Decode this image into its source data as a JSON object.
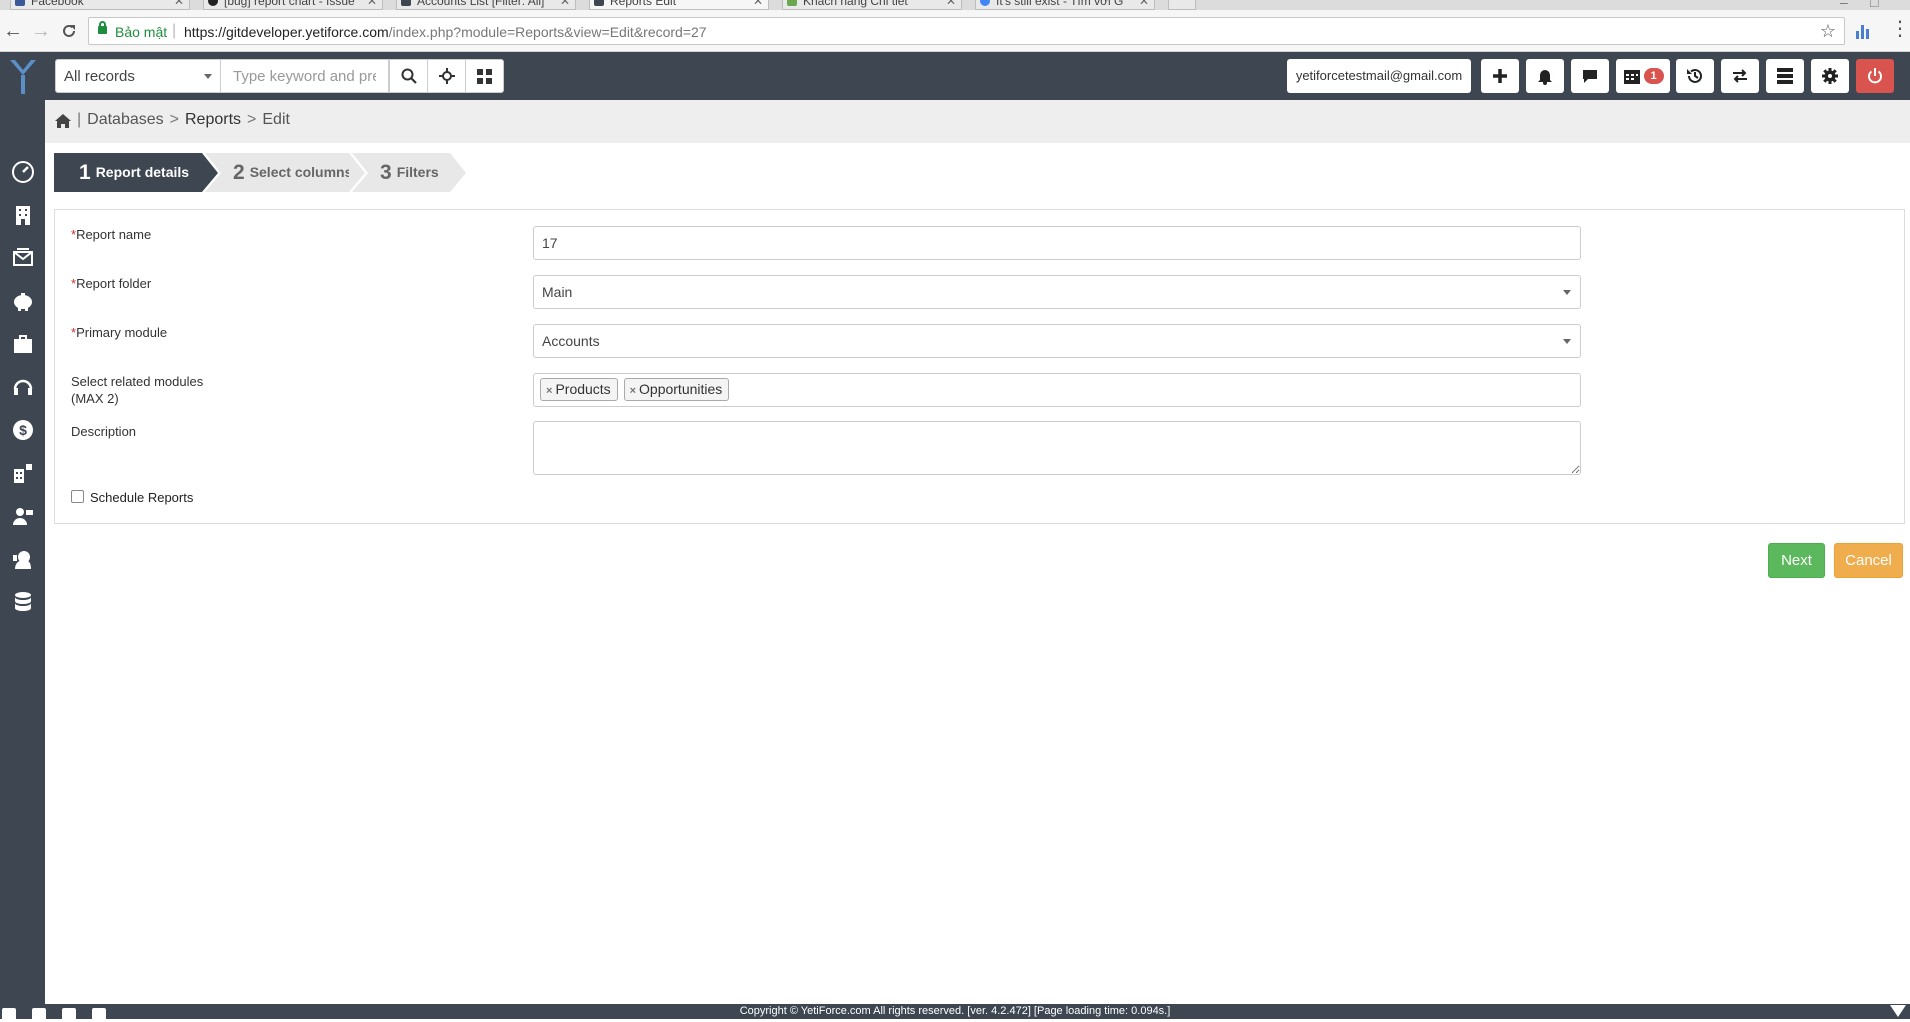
{
  "browser": {
    "tabs": [
      {
        "label": "Facebook",
        "active": false
      },
      {
        "label": "[bug] report chart - Issue",
        "active": false
      },
      {
        "label": "Accounts List [Filter: All]",
        "active": false
      },
      {
        "label": "Reports Edit",
        "active": true
      },
      {
        "label": "Khách hàng Chi tiết",
        "active": false
      },
      {
        "label": "It's still exist - Tìm với G",
        "active": false
      }
    ],
    "secure_label": "Bảo mật",
    "url_host": "https://gitdeveloper.yetiforce.com",
    "url_path": "/index.php?module=Reports&view=Edit&record=27"
  },
  "header": {
    "filter_value": "All records",
    "search_placeholder": "Type keyword and pre",
    "user_email": "yetiforcetestmail@gmail.com",
    "calendar_badge": "1"
  },
  "breadcrumb": {
    "level1": "Databases",
    "level2": "Reports",
    "level3": "Edit"
  },
  "steps": [
    {
      "num": "1",
      "label": "Report details"
    },
    {
      "num": "2",
      "label": "Select columns"
    },
    {
      "num": "3",
      "label": "Filters"
    }
  ],
  "form": {
    "required_mark": "*",
    "report_name_label": "Report name",
    "report_name_value": "17",
    "report_folder_label": "Report folder",
    "report_folder_value": "Main",
    "primary_module_label": "Primary module",
    "primary_module_value": "Accounts",
    "related_modules_label": "Select related modules",
    "related_modules_sub": "(MAX 2)",
    "related_modules": [
      "Products",
      "Opportunities"
    ],
    "remove_mark": "×",
    "description_label": "Description",
    "schedule_label": "Schedule Reports"
  },
  "actions": {
    "next_label": "Next",
    "cancel_label": "Cancel"
  },
  "footer": {
    "text": "Copyright © YetiForce.com All rights reserved. [ver. 4.2.472] [Page loading time: 0.094s.]"
  },
  "colors": {
    "sidebar": "#3d4651",
    "next": "#5cb85c",
    "cancel": "#f0ad4e",
    "logout": "#d9534f",
    "badge": "#d9534f"
  }
}
